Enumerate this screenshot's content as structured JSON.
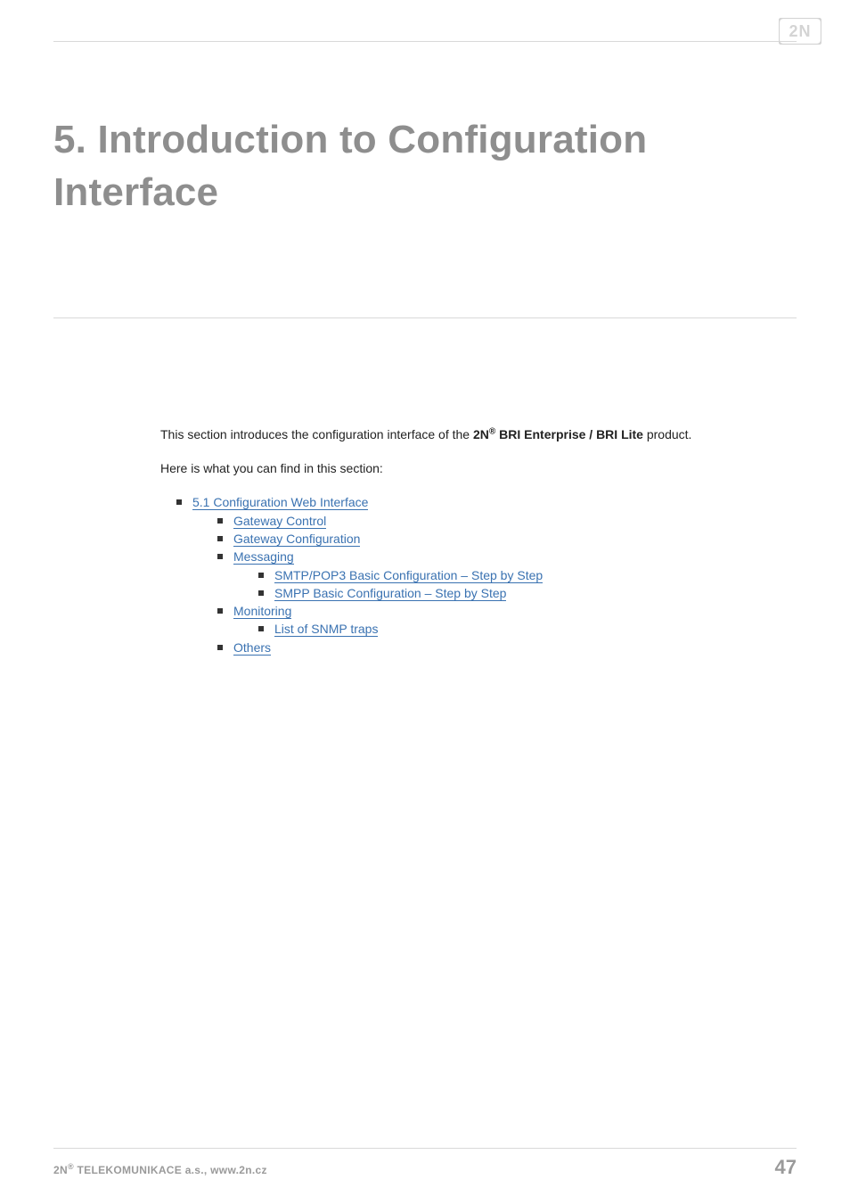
{
  "logo": {
    "alt": "2N"
  },
  "title": "5. Introduction to Configuration Interface",
  "intro": {
    "prefix": "This section introduces the configuration interface of the ",
    "brand_prefix": "2N",
    "brand_sup": "®",
    "brand_suffix": " BRI Enterprise / BRI Lite",
    "suffix": " product."
  },
  "lead": "Here is what you can find in this section:",
  "toc": {
    "l1_1": "5.1 Configuration Web Interface",
    "l2_1": "Gateway Control",
    "l2_2": "Gateway Configuration",
    "l2_3": "Messaging",
    "l3_1": "SMTP/POP3 Basic Configuration – Step by Step",
    "l3_2": "SMPP Basic Configuration – Step by Step",
    "l2_4": "Monitoring",
    "l3_3": "List of SNMP traps",
    "l2_5": "Others"
  },
  "footer": {
    "brand_prefix": "2N",
    "brand_sup": "®",
    "company": " TELEKOMUNIKACE a.s., www.2n.cz",
    "page": "47"
  }
}
